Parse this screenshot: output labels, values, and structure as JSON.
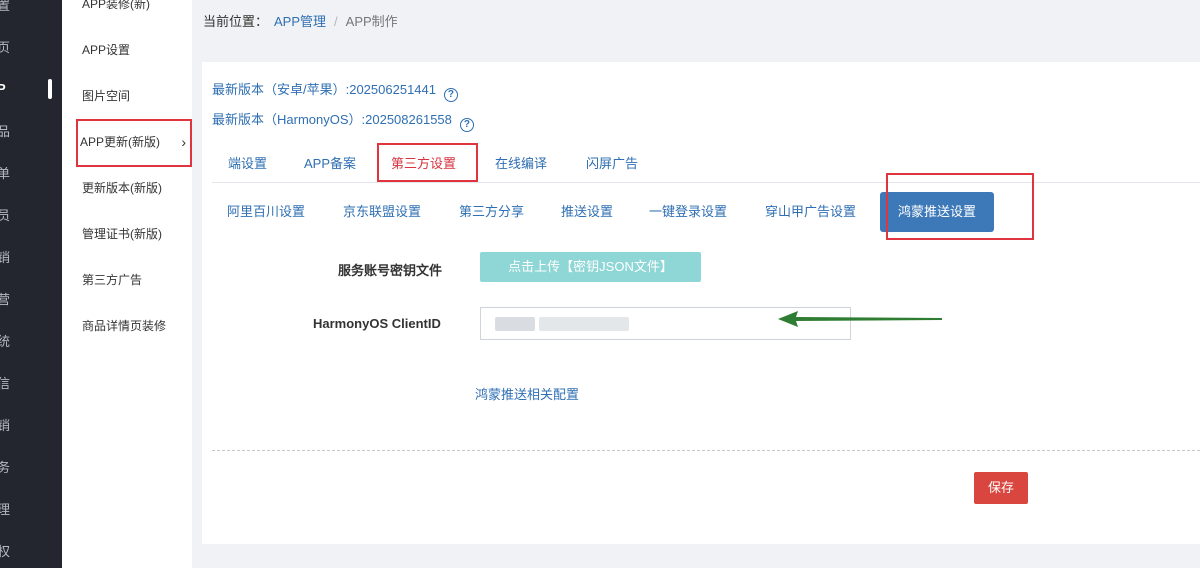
{
  "dark_nav": {
    "items": [
      "置",
      "页",
      "P",
      "品",
      "单",
      "员",
      "销",
      "营",
      "统",
      "信",
      "销",
      "务",
      "理",
      "权"
    ]
  },
  "sub_nav": {
    "items": [
      {
        "label": "APP装修(新)"
      },
      {
        "label": "APP设置"
      },
      {
        "label": "图片空间"
      },
      {
        "label": "APP更新(新版)"
      },
      {
        "label": "更新版本(新版)"
      },
      {
        "label": "管理证书(新版)"
      },
      {
        "label": "第三方广告"
      },
      {
        "label": "商品详情页装修"
      }
    ],
    "chevron": "›"
  },
  "breadcrumb": {
    "label": "当前位置：",
    "link": "APP管理",
    "separator": "/",
    "current": "APP制作"
  },
  "versions": {
    "android_ios": "最新版本（安卓/苹果）:202506251441",
    "harmony": "最新版本（HarmonyOS）:202508261558",
    "help_glyph": "?"
  },
  "tabs": [
    "端设置",
    "APP备案",
    "第三方设置",
    "在线编译",
    "闪屏广告"
  ],
  "subtabs": [
    "阿里百川设置",
    "京东联盟设置",
    "第三方分享",
    "推送设置",
    "一键登录设置",
    "穿山甲广告设置",
    "鸿蒙推送设置"
  ],
  "form": {
    "key_file_label": "服务账号密钥文件",
    "upload_label": "点击上传【密钥JSON文件】",
    "client_id_label": "HarmonyOS ClientID",
    "config_link": "鸿蒙推送相关配置"
  },
  "actions": {
    "save_label": "保存"
  },
  "colors": {
    "accent": "#2f6fb3",
    "active_tab": "#d9333f",
    "highlight": "#e0353f",
    "save": "#d9463f",
    "upload": "#8fd6d6",
    "arrow": "#2e7d32"
  }
}
